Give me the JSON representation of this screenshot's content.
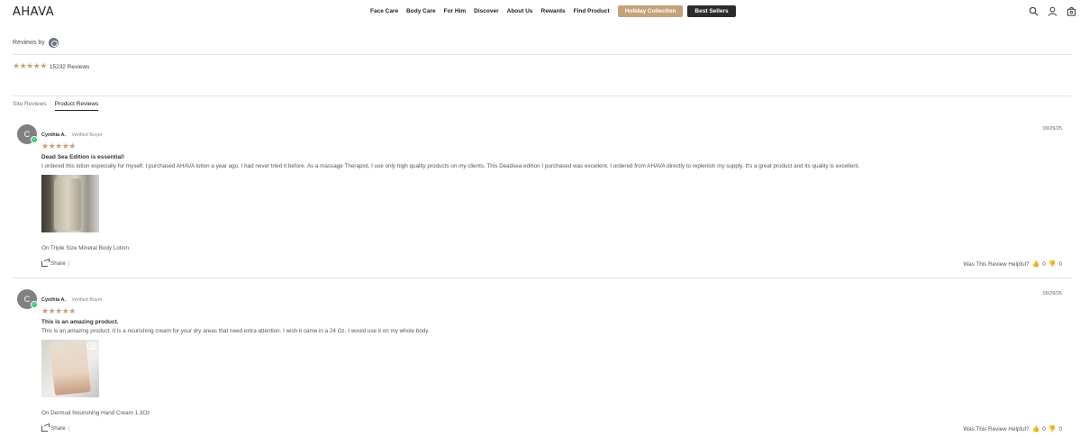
{
  "header": {
    "logo": "AHAVA",
    "nav": [
      "Face Care",
      "Body Care",
      "For Him",
      "Discover",
      "About Us",
      "Rewards",
      "Find Product"
    ],
    "pill_holiday": "Holiday Collection",
    "pill_best": "Best Sellers",
    "icons": [
      "search-icon",
      "user-icon",
      "cart-icon"
    ]
  },
  "reviews_by": "Reviews by",
  "summary": {
    "stars": "★★★★★",
    "count_text": "15232 Reviews",
    "rating": 5
  },
  "tabs": {
    "site": "Site Reviews",
    "product": "Product Reviews"
  },
  "reviews": [
    {
      "initial": "C",
      "name": "Cynthia A.",
      "verified": "Verified Buyer",
      "date": "09/29/25",
      "stars": "★★★★★",
      "title": "Dead Sea Edition is essential!",
      "text": "I ordered this lotion especially for myself. I purchased AHAVA lotion a year ago. I had never tried it before. As a massage Therapist, I use only high quality products on my clients. This Deadsea edition I purchased was excellent. I ordered from AHAVA directly to replenish my supply. It's a great product and its quality is excellent.",
      "product": "On Triple Size Mineral Body Lotion",
      "share": "Share",
      "helpful": "Was This Review Helpful?",
      "up": "0",
      "down": "0"
    },
    {
      "initial": "C",
      "name": "Cynthia A.",
      "verified": "Verified Buyer",
      "date": "09/29/25",
      "stars": "★★★★★",
      "title": "This is an amazing product.",
      "text": "This is an amazing product. It is a nourishing cream for your dry areas that need extra attention. I wish it came in a 24 Oz. I would use it on my whole body.",
      "product": "On Dermud Nourishing Hand Cream 1.3Oz",
      "share": "Share",
      "helpful": "Was This Review Helpful?",
      "up": "0",
      "down": "0"
    }
  ],
  "colors": {
    "gold": "#c4a27a",
    "dark": "#2b2b2b",
    "verified_green": "#2ecc71"
  }
}
